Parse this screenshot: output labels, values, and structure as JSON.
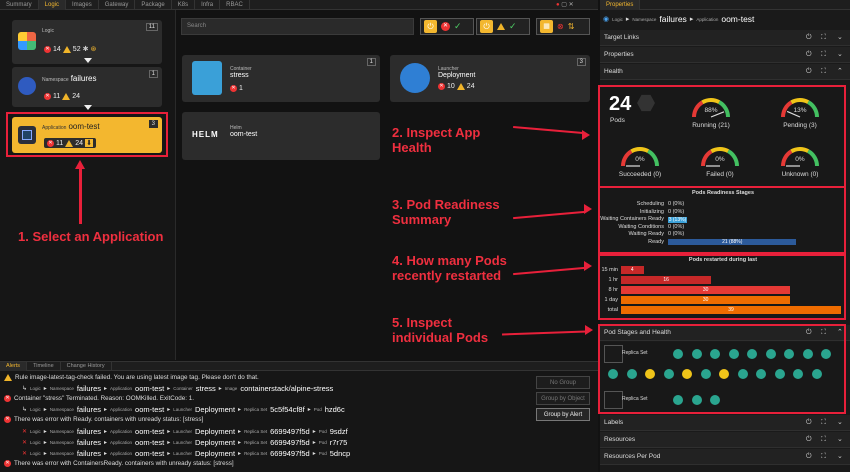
{
  "top_tabs": [
    "Summary",
    "Logic",
    "Images",
    "Gateway",
    "Package",
    "K8s",
    "Infra",
    "RBAC"
  ],
  "properties_tab": "Properties",
  "tree": {
    "logic": {
      "label": "Logic",
      "count": "11",
      "errors": "14",
      "warnings": "52"
    },
    "namespace": {
      "kind": "Namespace",
      "name": "failures",
      "count": "1",
      "errors": "11",
      "warnings": "24"
    },
    "application": {
      "kind": "Application",
      "name": "oom-test",
      "count": "3",
      "errors": "11",
      "warnings": "24"
    }
  },
  "search_placeholder": "Search",
  "nodes": [
    {
      "kind": "Container",
      "name": "stress",
      "count": "1",
      "errors": "1"
    },
    {
      "kind": "Launcher",
      "name": "Deployment",
      "count": "3",
      "errors": "10",
      "warnings": "24"
    },
    {
      "kind": "Helm",
      "name": "oom-test",
      "logo_text": "HELM"
    }
  ],
  "annotations": {
    "a1": "1. Select an Application",
    "a2a": "2. Inspect App",
    "a2b": "Health",
    "a3a": "3. Pod Readiness",
    "a3b": "Summary",
    "a4a": "4. How many Pods",
    "a4b": "recently restarted",
    "a5a": "5. Inspect",
    "a5b": "individual Pods"
  },
  "bottom_tabs": [
    "Alerts",
    "Timeline",
    "Change History"
  ],
  "alerts": [
    "Rule image-latest-tag-check failed. You are using latest image tag. Please don't do that.",
    "Container \"stress\" Terminated. Reason: OOMKilled. ExitCode: 1.",
    "There was error with Ready. containers with unready status: [stress]",
    "There was error with ContainersReady. containers with unready status: [stress]"
  ],
  "alert_paths": [
    {
      "ns": "failures",
      "app": "oom-test",
      "k3": "Container",
      "v3": "stress",
      "k4": "Image",
      "v4": "containerstack/alpine-stress"
    },
    {
      "ns": "failures",
      "app": "oom-test",
      "k3": "Launcher",
      "v3": "Deployment",
      "k4": "Replica Set",
      "v4": "5c5f54cf8f",
      "k5": "Pod",
      "v5": "hzd6c"
    },
    {
      "ns": "failures",
      "app": "oom-test",
      "k3": "Launcher",
      "v3": "Deployment",
      "k4": "Replica Set",
      "v4": "6699497f5d",
      "k5": "Pod",
      "v5": "9sdzf"
    },
    {
      "ns": "failures",
      "app": "oom-test",
      "k3": "Launcher",
      "v3": "Deployment",
      "k4": "Replica Set",
      "v4": "6699497f5d",
      "k5": "Pod",
      "v5": "r7r75"
    },
    {
      "ns": "failures",
      "app": "oom-test",
      "k3": "Launcher",
      "v3": "Deployment",
      "k4": "Replica Set",
      "v4": "6699497f5d",
      "k5": "Pod",
      "v5": "5dncp"
    }
  ],
  "path_labels": {
    "logic": "Logic",
    "namespace": "Namespace",
    "application": "Application"
  },
  "group_buttons": [
    "No Group",
    "Group by Object",
    "Group by Alert"
  ],
  "properties": {
    "head": {
      "logic": "Logic",
      "ns_kind": "Namespace",
      "ns": "failures",
      "app_kind": "Application",
      "app": "oom-test"
    },
    "sections_top": [
      "Target Links",
      "Properties",
      "Health"
    ],
    "sections_bottom": [
      "Labels",
      "Resources",
      "Resources Per Pod"
    ],
    "pods_total": "24",
    "pods_label": "Pods",
    "gauges": [
      {
        "label": "Running (21)",
        "pct": "88%",
        "value": 88
      },
      {
        "label": "Pending (3)",
        "pct": "13%",
        "value": 13
      },
      {
        "label": "Succeeded (0)",
        "pct": "0%",
        "value": 0
      },
      {
        "label": "Failed (0)",
        "pct": "0%",
        "value": 0
      },
      {
        "label": "Unknown (0)",
        "pct": "0%",
        "value": 0
      }
    ],
    "readiness": {
      "title": "Pods Readiness Stages",
      "rows": [
        {
          "label": "Scheduling",
          "value": "0 (0%)",
          "pct": 0
        },
        {
          "label": "Initializing",
          "value": "0 (0%)",
          "pct": 0
        },
        {
          "label": "Waiting Containers Ready",
          "value": "3 (13%)",
          "pct": 13
        },
        {
          "label": "Waiting Conditions",
          "value": "0 (0%)",
          "pct": 0
        },
        {
          "label": "Waiting Ready",
          "value": "0 (0%)",
          "pct": 0
        },
        {
          "label": "Ready",
          "value": "21 (88%)",
          "pct": 88
        }
      ]
    },
    "restarts": {
      "title": "Pods restarted during last",
      "rows": [
        {
          "label": "15 min",
          "value": "4",
          "n": 4
        },
        {
          "label": "1 hr",
          "value": "16",
          "n": 16
        },
        {
          "label": "8 hr",
          "value": "30",
          "n": 30
        },
        {
          "label": "1 day",
          "value": "30",
          "n": 30
        },
        {
          "label": "total",
          "value": "39",
          "n": 39
        }
      ]
    },
    "pod_stages_title": "Pod Stages and Health",
    "replica_label": "Replica Set"
  },
  "colors": {
    "accent": "#f3b72f",
    "annotation": "#e8203a",
    "pod_ok": "#2aa58f",
    "pod_pending": "#f0c419"
  }
}
